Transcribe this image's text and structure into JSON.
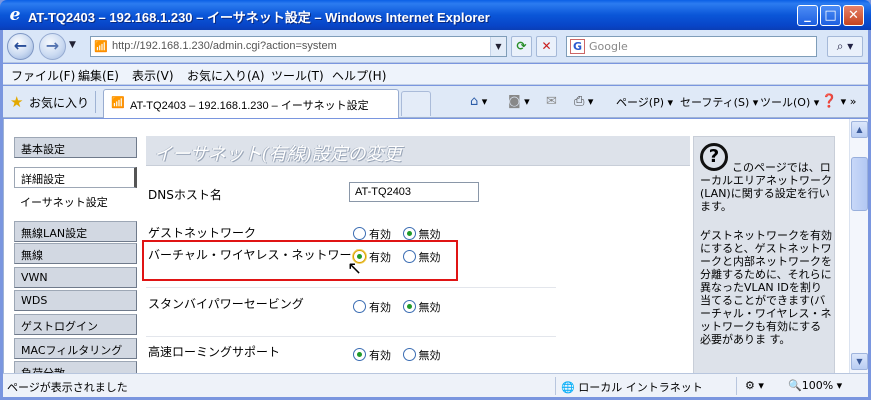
{
  "window": {
    "title": "AT-TQ2403 – 192.168.1.230 – イーサネット設定 – Windows Internet Explorer",
    "minimize": "_",
    "maximize": "□",
    "close": "✕"
  },
  "address": {
    "url": "http://192.168.1.230/admin.cgi?action=system",
    "search_placeholder": "Google"
  },
  "menu": [
    "ファイル(F)",
    "編集(E)",
    "表示(V)",
    "お気に入り(A)",
    "ツール(T)",
    "ヘルプ(H)"
  ],
  "favorites": {
    "label": "お気に入り",
    "tab_label": "AT-TQ2403 – 192.168.1.230 – イーサネット設定"
  },
  "tools": {
    "page": "ページ(P)",
    "safety": "セーフティ(S)",
    "tools": "ツール(O)"
  },
  "sidebar": {
    "items": [
      "基本設定",
      "詳細設定",
      "イーサネット設定",
      "無線LAN設定",
      "無線",
      "VWN",
      "WDS",
      "ゲストログイン",
      "MACフィルタリング",
      "負荷分散"
    ]
  },
  "panel": {
    "title": "イーサネット(有線)設定の変更",
    "dns_label": "DNSホスト名",
    "dns_value": "AT-TQ2403",
    "rows": [
      {
        "label": "ゲストネットワーク",
        "selected": "無効"
      },
      {
        "label": "バーチャル・ワイヤレス・ネットワーク",
        "selected": "有効"
      },
      {
        "label": "スタンバイパワーセービング",
        "selected": "無効"
      },
      {
        "label": "高速ローミングサポート",
        "selected": "有効"
      }
    ],
    "opt_on": "有効",
    "opt_off": "無効"
  },
  "help": {
    "q": "?",
    "text1": "このページでは、ローカルエリアネットワーク(LAN)に関する設定を行います。",
    "text2": "ゲストネットワークを有効にすると、ゲストネットワークと内部ネットワークを分離するために、それらに異なったVLAN IDを割り当てることができます(バーチャル・ワイヤレス・ネットワークも有効にする必要がありま す。"
  },
  "status": {
    "text": "ページが表示されました",
    "zone": "ローカル イントラネット",
    "zoom": "100%"
  }
}
